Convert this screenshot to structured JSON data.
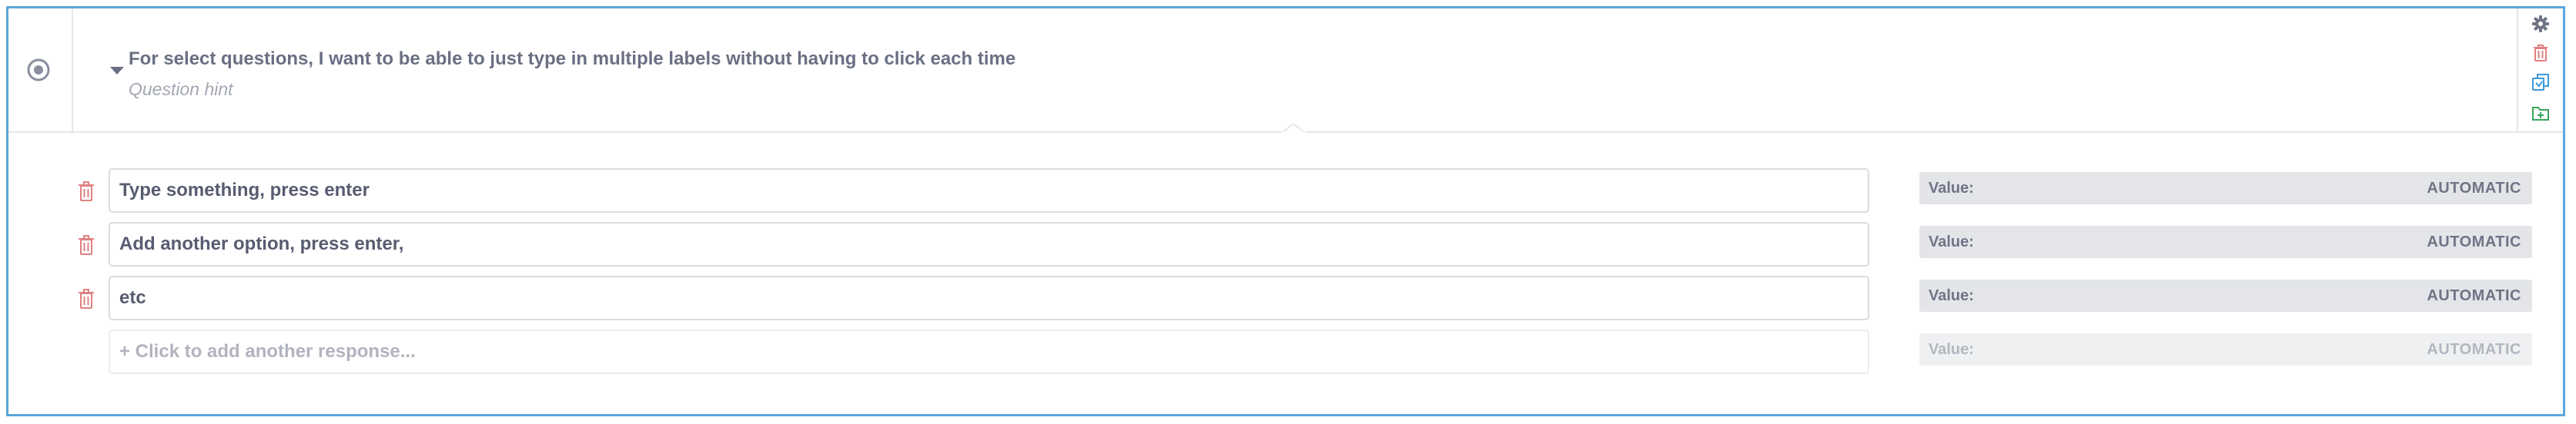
{
  "question": {
    "title": "For select questions, I want to be able to just type in multiple labels without having to click each time",
    "hint": "Question hint",
    "type_icon": "radio-icon",
    "tools": [
      "gear-icon",
      "trash-icon",
      "duplicate-icon",
      "add-to-library-icon"
    ]
  },
  "options": [
    {
      "label": "Type something, press enter",
      "value_label": "Value:",
      "value": "AUTOMATIC"
    },
    {
      "label": "Add another option, press enter,",
      "value_label": "Value:",
      "value": "AUTOMATIC"
    },
    {
      "label": "etc",
      "value_label": "Value:",
      "value": "AUTOMATIC"
    }
  ],
  "add_option": {
    "label": "+ Click to add another response...",
    "value_label": "Value:",
    "value": "AUTOMATIC"
  },
  "colors": {
    "accent_border": "#5aa6db",
    "delete_red": "#e08080",
    "duplicate_blue": "#3a9ad9",
    "library_green": "#3aa35a",
    "text_dark": "#575c70"
  }
}
